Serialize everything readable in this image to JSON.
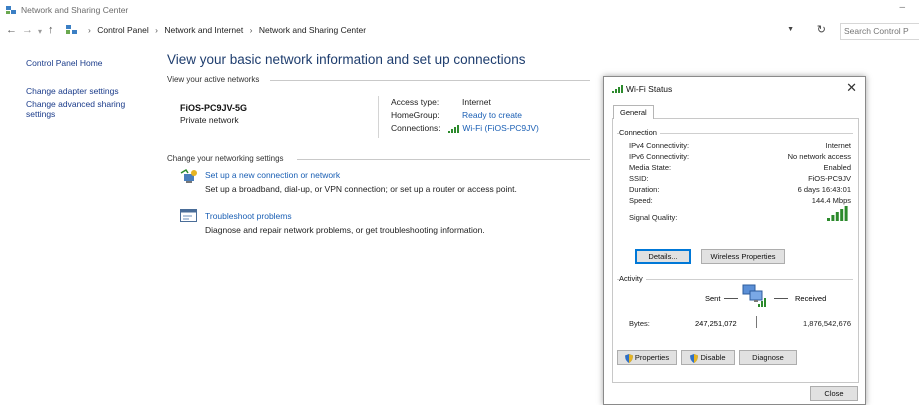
{
  "window": {
    "title": "Network and Sharing Center"
  },
  "address": {
    "crumbs": [
      "Control Panel",
      "Network and Internet",
      "Network and Sharing Center"
    ],
    "search_placeholder": "Search Control P"
  },
  "sidebar": {
    "home": "Control Panel Home",
    "links": [
      "Change adapter settings",
      "Change advanced sharing settings"
    ]
  },
  "main": {
    "title": "View your basic network information and set up connections",
    "active_networks_label": "View your active networks",
    "network": {
      "name": "FiOS-PC9JV-5G",
      "category": "Private network",
      "access_type_label": "Access type:",
      "access_type": "Internet",
      "homegroup_label": "HomeGroup:",
      "homegroup": "Ready to create",
      "connections_label": "Connections:",
      "connections": "Wi-Fi (FiOS-PC9JV)"
    },
    "change_settings_label": "Change your networking settings",
    "tasks": [
      {
        "link": "Set up a new connection or network",
        "desc": "Set up a broadband, dial-up, or VPN connection; or set up a router or access point."
      },
      {
        "link": "Troubleshoot problems",
        "desc": "Diagnose and repair network problems, or get troubleshooting information."
      }
    ]
  },
  "dialog": {
    "title": "Wi-Fi Status",
    "tab": "General",
    "connection_label": "Connection",
    "rows": [
      {
        "label": "IPv4 Connectivity:",
        "value": "Internet"
      },
      {
        "label": "IPv6 Connectivity:",
        "value": "No network access"
      },
      {
        "label": "Media State:",
        "value": "Enabled"
      },
      {
        "label": "SSID:",
        "value": "FiOS-PC9JV"
      },
      {
        "label": "Duration:",
        "value": "6 days 16:43:01"
      },
      {
        "label": "Speed:",
        "value": "144.4 Mbps"
      }
    ],
    "signal_label": "Signal Quality:",
    "signal_bars": 5,
    "details_btn": "Details...",
    "wireless_btn": "Wireless Properties",
    "activity_label": "Activity",
    "sent_label": "Sent",
    "received_label": "Received",
    "bytes_label": "Bytes:",
    "bytes_sent": "247,251,072",
    "bytes_received": "1,876,542,676",
    "properties_btn": "Properties",
    "disable_btn": "Disable",
    "diagnose_btn": "Diagnose",
    "close_btn": "Close"
  },
  "colors": {
    "link": "#1a5fb4",
    "heading": "#1e3d6e",
    "signal": "#2c8a2c",
    "focus": "#0078d7"
  }
}
